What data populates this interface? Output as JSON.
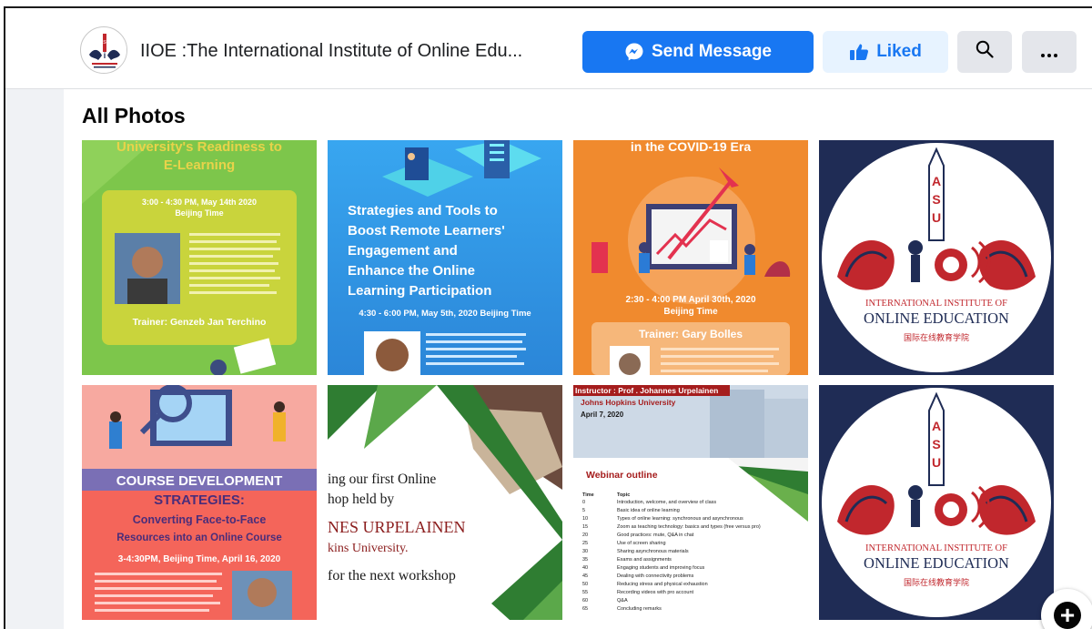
{
  "header": {
    "page_title": "IIOE :The International Institute of Online Edu...",
    "send_message_label": "Send Message",
    "liked_label": "Liked",
    "logo_text": "ASU"
  },
  "section": {
    "title": "All Photos"
  },
  "photos": [
    {
      "name": "University readiness e-learning poster",
      "title1": "University's Readiness to",
      "title2": "E-Learning",
      "time": "3:00 - 4:30 PM, May 14th 2020",
      "zone": "Beijing Time",
      "trainer": "Trainer: Genzeb Jan Terchino"
    },
    {
      "name": "Strategies and tools poster",
      "t1": "Strategies and Tools to",
      "t2": "Boost Remote Learners'",
      "t3": "Engagement and",
      "t4": "Enhance the Online",
      "t5": "Learning Participation",
      "time": "4:30 - 6:00 PM, May 5th, 2020 Beijing Time"
    },
    {
      "name": "COVID-19 era poster",
      "title": "in the COVID-19 Era",
      "time": "2:30 - 4:00 PM April 30th, 2020",
      "zone": "Beijing Time",
      "trainer": "Trainer: Gary Bolles"
    },
    {
      "name": "IIOE logo",
      "letters": [
        "A",
        "S",
        "U"
      ],
      "line1": "INTERNATIONAL INSTITUTE OF",
      "line2": "ONLINE EDUCATION",
      "line3": "国际在线教育学院"
    },
    {
      "name": "Course development strategies poster",
      "t1": "COURSE DEVELOPMENT",
      "t2": "STRATEGIES:",
      "t3": "Converting Face-to-Face",
      "t4": "Resources into an Online Course",
      "time": "3-4:30PM, Beijing Time, April 16, 2020"
    },
    {
      "name": "First online workshop poster",
      "l1": "ing our first Online",
      "l2": "hop held by",
      "l3": "NES URPELAINEN",
      "l4": "kins University.",
      "l5": "for the next workshop"
    },
    {
      "name": "Webinar outline poster",
      "instructor": "Instructor : Prof . Johannes Urpelainen",
      "university": "Johns Hopkins University",
      "date": "April 7, 2020",
      "heading": "Webinar outline",
      "col_time": "Time",
      "col_topic": "Topic",
      "rows": [
        [
          "0",
          "Introduction, welcome, and overview of class"
        ],
        [
          "5",
          "Basic idea of online learning"
        ],
        [
          "10",
          "Types of online learning: synchronous and asynchronous"
        ],
        [
          "15",
          "Zoom as teaching technology: basics and types (free versus pro)"
        ],
        [
          "20",
          "Good practices: mute, Q&A in chat"
        ],
        [
          "25",
          "Use of screen sharing"
        ],
        [
          "30",
          "Sharing asynchronous materials"
        ],
        [
          "35",
          "Exams and assignments"
        ],
        [
          "40",
          "Engaging students and improving focus"
        ],
        [
          "45",
          "Dealing with connectivity problems"
        ],
        [
          "50",
          "Reducing stress and physical exhaustion"
        ],
        [
          "55",
          "Recording videos with pro account"
        ],
        [
          "60",
          "Q&A"
        ],
        [
          "65",
          "Concluding remarks"
        ]
      ]
    },
    {
      "name": "IIOE logo",
      "letters": [
        "A",
        "S",
        "U"
      ],
      "line1": "INTERNATIONAL INSTITUTE OF",
      "line2": "ONLINE EDUCATION",
      "line3": "国际在线教育学院"
    }
  ],
  "colors": {
    "brand_blue": "#1877f2",
    "liked_bg": "#e7f3ff",
    "logo_navy": "#1f2c55",
    "logo_red": "#c1272d"
  }
}
